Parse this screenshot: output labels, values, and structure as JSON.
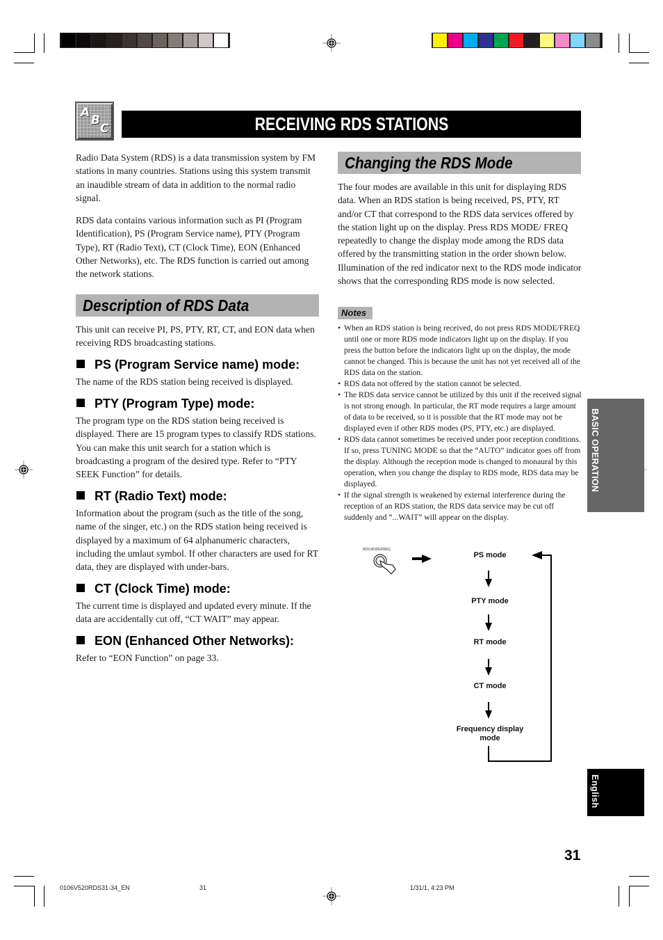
{
  "color_bars": {
    "grayscale": [
      "#000000",
      "#0d0b0a",
      "#1a1615",
      "#272220",
      "#3d3432",
      "#524846",
      "#6b615e",
      "#857b78",
      "#a79d9b",
      "#d0c8c6",
      "#ffffff"
    ],
    "process": [
      "#fff200",
      "#ec008c",
      "#00aeef",
      "#2e3192",
      "#00a651",
      "#ed1c24",
      "#231f20",
      "#fff77f",
      "#f68bc8",
      "#7fd6f7",
      "#8c8a8a"
    ]
  },
  "header": {
    "icon_letters": [
      "A",
      "B",
      "C"
    ],
    "title": "RECEIVING RDS STATIONS"
  },
  "left": {
    "intro_1": "Radio Data System (RDS) is a data transmission system by FM stations in many countries. Stations using this system transmit an inaudible stream of data in addition to the normal radio signal.",
    "intro_2": "RDS data contains various information such as PI (Program Identification), PS (Program Service name), PTY (Program Type), RT (Radio Text), CT (Clock Time), EON (Enhanced Other Networks), etc. The RDS function is carried out among the network stations.",
    "section_title": "Description of RDS Data",
    "section_intro": "This unit can receive PI, PS, PTY, RT, CT, and EON data when receiving RDS broadcasting stations.",
    "modes": [
      {
        "heading": "PS (Program Service name) mode:",
        "body": "The name of the RDS station being received is displayed."
      },
      {
        "heading": "PTY (Program Type) mode:",
        "body": "The program type on the RDS station being received is displayed. There are 15 program types to classify RDS stations. You can make this unit search for a station which is broadcasting a program of the desired type. Refer to “PTY SEEK Function” for details."
      },
      {
        "heading": "RT (Radio Text) mode:",
        "body": "Information about the program (such as the title of the song, name of the singer, etc.) on the RDS station being received is displayed by a maximum of 64 alphanumeric characters, including the umlaut symbol. If other characters are used for RT data, they are displayed with under-bars."
      },
      {
        "heading": "CT (Clock Time) mode:",
        "body": "The current time is displayed and updated every minute. If the data are accidentally cut off, “CT WAIT” may appear."
      },
      {
        "heading": "EON (Enhanced Other Networks):",
        "body": "Refer to “EON Function” on page 33."
      }
    ]
  },
  "right": {
    "section_title": "Changing the RDS Mode",
    "body": "The four modes are available in this unit for displaying RDS data. When an RDS station is being received, PS, PTY, RT and/or CT that correspond to the RDS data services offered by the station light up on the display. Press RDS MODE/ FREQ repeatedly to change the display mode among the RDS data offered by the transmitting station in the order shown below. Illumination of the red indicator next to the RDS mode indicator shows that the corresponding RDS mode is now selected.",
    "notes_label": "Notes",
    "notes": [
      "When an RDS station is being received, do not press RDS MODE/FREQ until one or more RDS mode indicators light up on the display. If you press the button before the indicators light up on the display, the mode cannot be changed. This is because the unit has not yet received all of the RDS data on the station.",
      "RDS data not offered by the station cannot be selected.",
      "The RDS data service cannot be utilized by this unit if the received signal is not strong enough. In particular, the RT mode requires a large amount of data to be received, so it is possible that the RT mode may not be displayed even if other RDS modes (PS, PTY, etc.) are displayed.",
      "RDS data cannot sometimes be received under poor reception conditions. If so, press TUNING MODE so that the “AUTO” indicator goes off from the display. Although the reception mode is changed to monaural by this operation, when you change the display to RDS mode, RDS data may be displayed.",
      "If the signal strength is weakened by external interference during the reception of an RDS station, the RDS data service may be cut off suddenly and “...WAIT” will appear on the display."
    ],
    "flow": {
      "button_label": "RDS MODE/FREQ",
      "steps": [
        "PS mode",
        "PTY mode",
        "RT mode",
        "CT mode",
        "Frequency display mode"
      ]
    }
  },
  "side_tabs": {
    "section": "BASIC OPERATION",
    "language": "English"
  },
  "page_number": "31",
  "footer": {
    "file": "0106V520RDS31-34_EN",
    "page": "31",
    "timestamp": "1/31/1, 4:23 PM"
  }
}
